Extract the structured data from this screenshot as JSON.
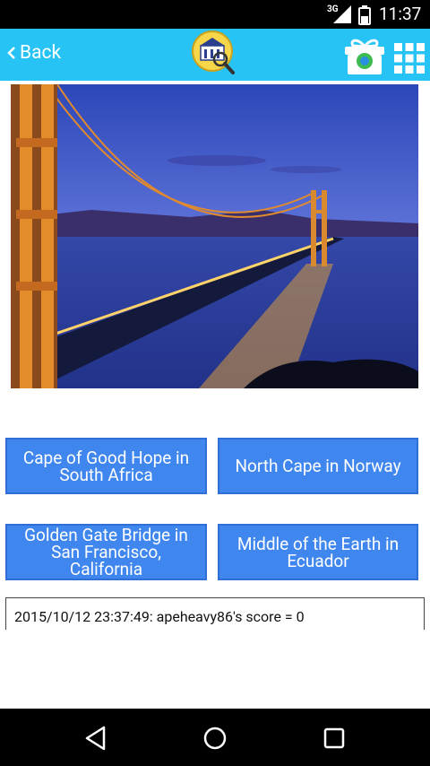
{
  "status_bar": {
    "network": "3G",
    "time": "11:37"
  },
  "app_bar": {
    "back_label": "Back"
  },
  "answers": [
    "Cape of Good Hope in South Africa",
    "North Cape in Norway",
    "Golden Gate Bridge in San Francisco, California",
    "Middle of the Earth in Ecuador"
  ],
  "log": {
    "entry": "2015/10/12 23:37:49: apeheavy86's score = 0"
  }
}
